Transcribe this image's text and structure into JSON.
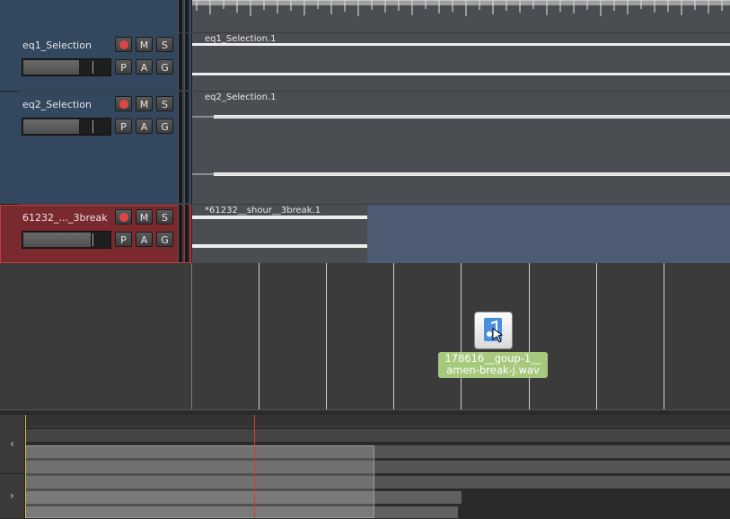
{
  "tracks": [
    {
      "name": "eq1_Selection",
      "region": "eq1_Selection.1",
      "color": "#33475f"
    },
    {
      "name": "eq2_Selection",
      "region": "eq2_Selection.1",
      "color": "#33475f"
    },
    {
      "name": "61232_..._3break",
      "region": "*61232__shour__3break.1",
      "color": "#7a2a2e"
    }
  ],
  "buttons": {
    "mute": "M",
    "solo": "S",
    "playlist": "P",
    "automation": "A",
    "group": "G"
  },
  "drag": {
    "file_line1": "178616__goup-1__",
    "file_line2": "amen-break-j.wav",
    "icon": "audio-file-icon"
  },
  "summary": {
    "prev": "‹",
    "next": "›"
  },
  "colors": {
    "accent_green": "#a6c97e",
    "playhead": "#d23a3a",
    "track_blue": "#33475f",
    "track_red": "#7a2a2e"
  }
}
